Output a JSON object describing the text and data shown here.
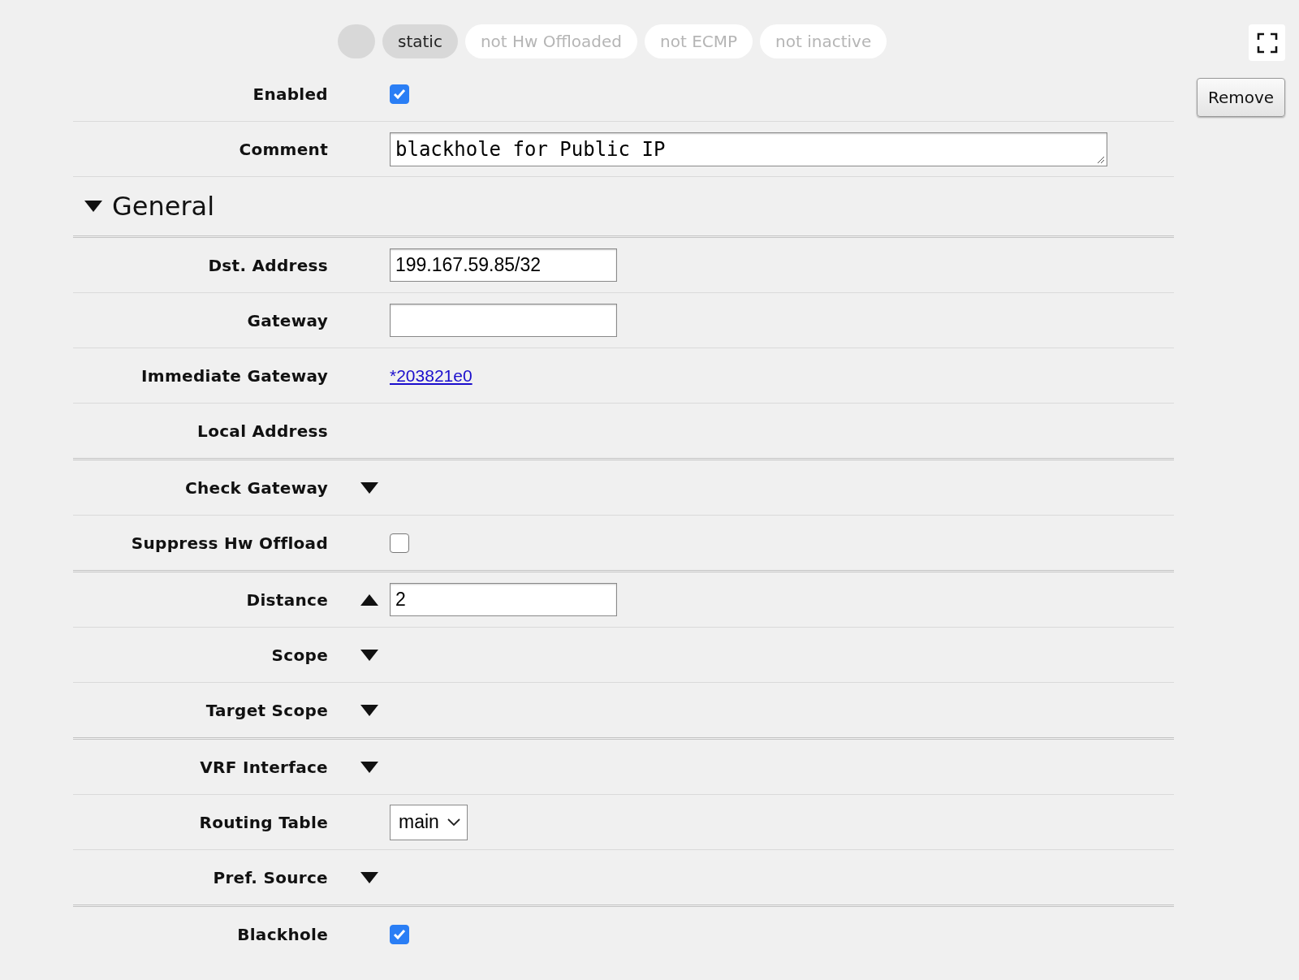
{
  "flags": [
    {
      "label": "static",
      "selected": true
    },
    {
      "label": "not Hw Offloaded",
      "selected": false
    },
    {
      "label": "not ECMP",
      "selected": false
    },
    {
      "label": "not inactive",
      "selected": false
    }
  ],
  "remove_button": "Remove",
  "top_rows": [
    {
      "kind": "checkbox",
      "label": "Enabled",
      "checked": true
    },
    {
      "kind": "textarea",
      "label": "Comment",
      "value": "blackhole for Public IP"
    }
  ],
  "section": {
    "title": "General",
    "expanded": true,
    "groups": [
      [
        {
          "kind": "input",
          "label": "Dst. Address",
          "value": "199.167.59.85/32"
        },
        {
          "kind": "input",
          "label": "Gateway"
        },
        {
          "kind": "link",
          "label": "Immediate Gateway",
          "value": "*203821e0"
        },
        {
          "kind": "empty",
          "label": "Local Address"
        }
      ],
      [
        {
          "kind": "toggle",
          "label": "Check Gateway",
          "expanded": false
        },
        {
          "kind": "checkbox",
          "label": "Suppress Hw Offload",
          "checked": false
        }
      ],
      [
        {
          "kind": "toggle",
          "label": "Distance",
          "expanded": true,
          "value": "2"
        },
        {
          "kind": "toggle",
          "label": "Scope",
          "expanded": false
        },
        {
          "kind": "toggle",
          "label": "Target Scope",
          "expanded": false
        }
      ],
      [
        {
          "kind": "toggle",
          "label": "VRF Interface",
          "expanded": false
        },
        {
          "kind": "select",
          "label": "Routing Table",
          "value": "main"
        },
        {
          "kind": "toggle",
          "label": "Pref. Source",
          "expanded": false
        }
      ],
      [
        {
          "kind": "checkbox",
          "label": "Blackhole",
          "checked": true
        }
      ]
    ]
  }
}
